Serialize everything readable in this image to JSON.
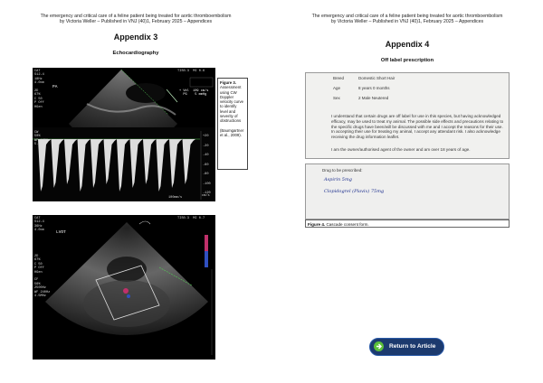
{
  "header": {
    "line1": "The emergency and critical care of a feline patient being treated for aortic thromboembolism",
    "line2": "by Victoria Weller – Published in VNJ (40)1, February 2025 – Appendices"
  },
  "left": {
    "appendix_title": "Appendix 3",
    "section_title": "Echocardiography",
    "echo1": {
      "overlay_top_left": "CAT\nS12-4\n18Hz\n4.0cm\n\n2D\n67%\nC 50\nP Off\nHGen",
      "label_pa": "PA",
      "overlay_top_right": "TIS0.3  MI 0.6",
      "measure": "+ Vel  109 cm/s\n  PG    5 mmHg",
      "overlay_cw": "CW\n50%\nWF 125Hz\n5.3MHz",
      "scale_ticks": [
        "+20",
        "-20",
        "-40",
        "-60",
        "-80",
        "-100",
        "-120"
      ],
      "scale_unit": "cm/s",
      "sweep_label": "100mm/s"
    },
    "caption": {
      "title": "Figure 3.",
      "body": "Assessment using CW Doppler velocity curve to identify level and severity of obstructions",
      "ref": "(Baumgartner et al., 2009)."
    },
    "echo2": {
      "overlay_top_left": "CAT\nS12-4\n36Hz\n4.0cm",
      "label_lvot": "LVOT",
      "overlay_top_right": "TIS0.3  MI 0.7",
      "overlay_side": "2D\n67%\nC 50\nP Off\nHGen\n\nCF\n56%\n2500Hz\nWF 240Hz\n4.5MHz"
    }
  },
  "right": {
    "appendix_title": "Appendix 4",
    "section_title": "Off label prescription",
    "form": {
      "rows": [
        {
          "label": "Breed",
          "value": "Domestic Short Hair"
        },
        {
          "label": "Age",
          "value": "8 years 0 months"
        },
        {
          "label": "Sex",
          "value": "2 Male Neutered"
        }
      ],
      "paragraph1": "I understand that certain drugs are off label for use in this species, but having acknowledged efficacy, may be used to treat my animal. The possible side effects and precautions relating to the specific drugs have been/will be discussed with me and I accept the reasons for their use. In accepting their use for treating my animal, I accept any attendant risk. I also acknowledge receiving the drug information leaflet.",
      "paragraph2": "I am the owner/authorised agent of the owner and am over 18 years of age."
    },
    "drugs": {
      "heading": "Drug to be prescribed:",
      "line1": "Aspirin 5mg",
      "line2": "Clopidogrel (Plavix) 75mg"
    },
    "caption": {
      "title": "Figure 4.",
      "body": "Cascade consent form."
    },
    "return_button": "Return to Article"
  },
  "colors": {
    "button_bg": "#1c3a6e",
    "button_icon": "#5bbf3a",
    "ink": "#1d2f8e"
  }
}
